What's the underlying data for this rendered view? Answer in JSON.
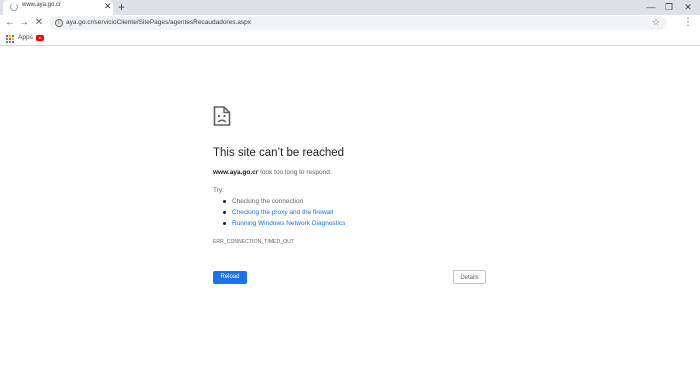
{
  "tab": {
    "title": "www.aya.go.cr",
    "close": "✕"
  },
  "new_tab": "+",
  "window_controls": {
    "minimize": "—",
    "maximize": "❐",
    "close": "✕"
  },
  "toolbar": {
    "back": "←",
    "forward": "→",
    "stop": "✕",
    "url": "aya.go.cr/servicioCliente/SitePages/agentesRecaudadores.aspx",
    "star": "☆",
    "menu": "⋮"
  },
  "bookmarks": {
    "apps_label": "Apps"
  },
  "error": {
    "heading": "This site can’t be reached",
    "host": "www.aya.go.cr",
    "summary_suffix": " took too long to respond.",
    "try_label": "Try:",
    "suggestions": [
      "Checking the connection",
      "Checking the proxy and the firewall",
      "Running Windows Network Diagnostics"
    ],
    "error_code": "ERR_CONNECTION_TIMED_OUT",
    "reload_label": "Reload",
    "details_label": "Details"
  },
  "colors": {
    "accent": "#1a73e8",
    "tabstrip": "#dee1e6",
    "omnibox": "#f1f3f4",
    "youtube": "#ff0000"
  }
}
